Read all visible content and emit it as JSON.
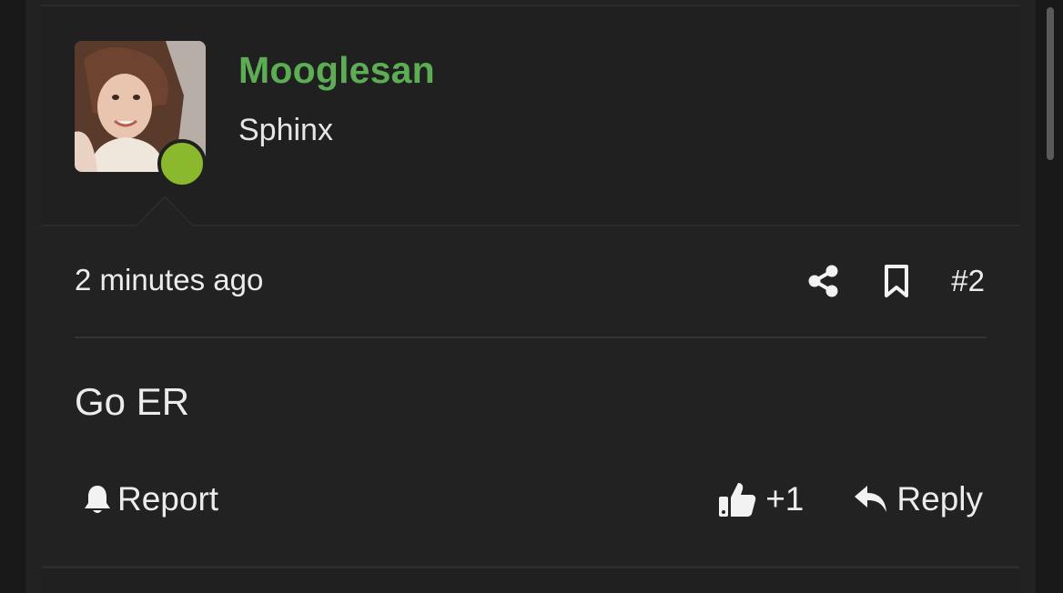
{
  "post": {
    "author": {
      "username": "Mooglesan",
      "title": "Sphinx",
      "online": true,
      "username_color": "#5cad54",
      "online_color": "#8ab92d"
    },
    "meta": {
      "timestamp": "2 minutes ago",
      "post_number": "#2",
      "share_icon": "share-icon",
      "bookmark_icon": "bookmark-icon"
    },
    "body": "Go ER",
    "footer": {
      "report_label": "Report",
      "report_icon": "bell-icon",
      "like_count": "+1",
      "like_icon": "thumbs-up-icon",
      "reply_label": "Reply",
      "reply_icon": "reply-arrow-icon"
    }
  },
  "theme": {
    "background": "#181818",
    "card": "#222222",
    "text": "#ececec"
  }
}
